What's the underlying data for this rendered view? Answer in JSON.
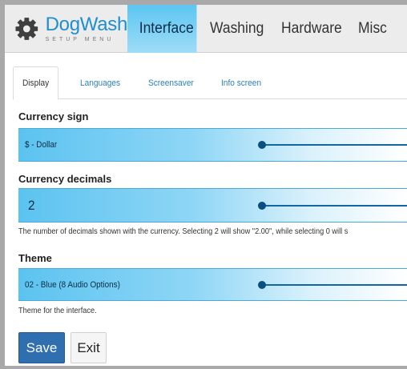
{
  "app": {
    "brand": "DogWash",
    "tagline": "SETUP MENU"
  },
  "nav": {
    "tabs": [
      {
        "label": "Interface",
        "active": true
      },
      {
        "label": "Washing",
        "active": false
      },
      {
        "label": "Hardware",
        "active": false
      },
      {
        "label": "Misc",
        "active": false
      }
    ]
  },
  "subtabs": [
    {
      "label": "Display",
      "active": true
    },
    {
      "label": "Languages",
      "active": false
    },
    {
      "label": "Screensaver",
      "active": false
    },
    {
      "label": "Info screen",
      "active": false
    }
  ],
  "form": {
    "currency_sign": {
      "label": "Currency sign",
      "value": "$ - Dollar"
    },
    "currency_decimals": {
      "label": "Currency decimals",
      "value": "2",
      "help": "The number of decimals shown with the currency. Selecting 2 will show \"2.00\", while selecting 0 will s"
    },
    "theme": {
      "label": "Theme",
      "value": "02 - Blue (8 Audio Options)",
      "help": "Theme for the interface."
    }
  },
  "buttons": {
    "save": "Save",
    "exit": "Exit"
  },
  "colors": {
    "accent": "#1e8fd0",
    "field_gradient_start": "#5bc3f0",
    "save_button": "#2f6fb0",
    "slider": "#0b4f80"
  },
  "icons": {
    "logo": "gear-icon"
  }
}
